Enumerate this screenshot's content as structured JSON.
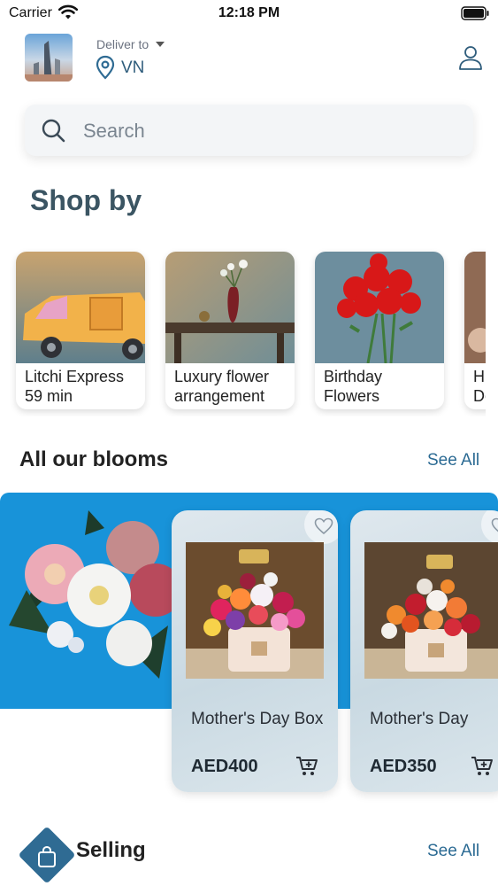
{
  "status_bar": {
    "carrier": "Carrier",
    "time": "12:18 PM"
  },
  "header": {
    "deliver_label": "Deliver to",
    "location": "VN"
  },
  "search": {
    "placeholder": "Search"
  },
  "shop_by": {
    "title": "Shop by",
    "categories": [
      {
        "label": "Litchi Express\n59 min"
      },
      {
        "label": "Luxury flower\narrangement"
      },
      {
        "label": "Birthday\nFlowers"
      },
      {
        "label": "H\nDe"
      }
    ]
  },
  "all_blooms": {
    "title": "All our blooms",
    "see_all": "See All",
    "products": [
      {
        "name": "Mother's Day Box",
        "price": "AED400"
      },
      {
        "name": "Mother's Day",
        "price": "AED350"
      }
    ]
  },
  "best_selling": {
    "title_partial": "Selling",
    "see_all": "See All"
  },
  "colors": {
    "accent": "#2b6a93",
    "banner": "#1893d9",
    "title": "#3b5563"
  },
  "icons": [
    "wifi-icon",
    "battery-icon",
    "location-pin-icon",
    "profile-icon",
    "search-icon",
    "heart-icon",
    "cart-icon",
    "shopping-bag-icon"
  ]
}
